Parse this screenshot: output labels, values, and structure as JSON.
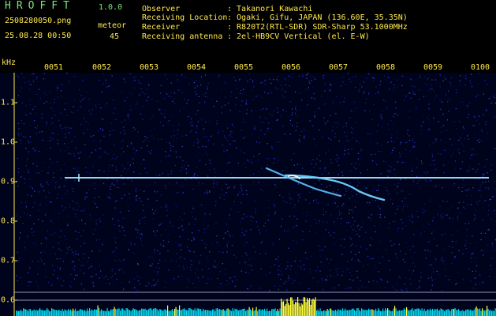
{
  "header": {
    "app_title": "HROFFT",
    "app_version": "1.0.0",
    "file_name": "2508280050.png",
    "timestamp": "25.08.28 00:50",
    "meteor_label": "meteor",
    "meteor_count": "45"
  },
  "info": [
    {
      "label": "Observer",
      "value": ": Takanori Kawachi"
    },
    {
      "label": "Receiving Location",
      "value": ": Ogaki, Gifu, JAPAN (136.60E, 35.35N)"
    },
    {
      "label": "Receiver",
      "value": ": R820T2(RTL-SDR) SDR-Sharp 53.1000MHz"
    },
    {
      "label": "Receiving antenna",
      "value": ": 2el-HB9CV Vertical (el. E-W)"
    }
  ],
  "axis": {
    "y_unit": "kHz",
    "x_ticks": [
      "0051",
      "0052",
      "0053",
      "0054",
      "0055",
      "0056",
      "0057",
      "0058",
      "0059",
      "0100"
    ],
    "y_ticks": [
      "1.1",
      "1.0",
      "0.9",
      "0.8",
      "0.7",
      "0.6"
    ]
  },
  "colors": {
    "background": "#000000",
    "header_text": "#ffe94a",
    "title_text": "#7fe37a",
    "noise": "#1c2a8a",
    "signal": "#8fe8ff",
    "power_bar": "#00e5ff",
    "power_peak": "#ffff3a"
  }
}
